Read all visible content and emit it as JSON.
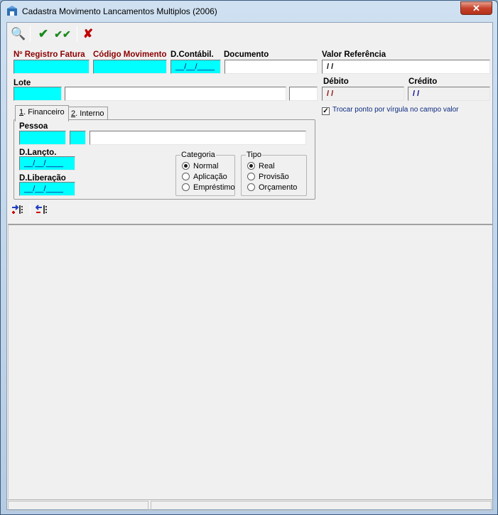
{
  "window": {
    "title": "Cadastra Movimento Lancamentos Multiplos (2006)",
    "close_label": "✕"
  },
  "toolbar": {
    "search_glyph": "🔍",
    "confirm_glyph": "✔",
    "confirm_all_glyph": "✔✔",
    "cancel_glyph": "✘"
  },
  "fields": {
    "registro_fatura": {
      "label": "Nº Registro Fatura",
      "value": ""
    },
    "codigo_movimento": {
      "label": "Código Movimento",
      "value": ""
    },
    "d_contabil": {
      "label": "D.Contábil.",
      "value": "__/__/____"
    },
    "documento": {
      "label": "Documento",
      "value": ""
    },
    "valor_referencia": {
      "label": "Valor Referência",
      "value": " / /"
    },
    "lote": {
      "label": "Lote",
      "value": "",
      "desc": "",
      "extra": ""
    },
    "debito": {
      "label": "Débito",
      "value": " / /"
    },
    "credito": {
      "label": "Crédito",
      "value": " / /"
    }
  },
  "tabs": [
    {
      "label_prefix": "1",
      "label": ". Financeiro"
    },
    {
      "label_prefix": "2",
      "label": ". Interno"
    }
  ],
  "financeiro": {
    "pessoa": {
      "label": "Pessoa",
      "code": "",
      "sub": "",
      "name": ""
    },
    "d_lancto": {
      "label": "D.Lançto.",
      "value": "__/__/____"
    },
    "d_liberacao": {
      "label": "D.Liberação",
      "value": "__/__/____"
    },
    "categoria": {
      "title": "Categoria",
      "options": [
        "Normal",
        "Aplicação",
        "Empréstimo"
      ],
      "selected": "Normal"
    },
    "tipo": {
      "title": "Tipo",
      "options": [
        "Real",
        "Provisão",
        "Orçamento"
      ],
      "selected": "Real"
    }
  },
  "options": {
    "trocar_ponto": {
      "label": "Trocar ponto por vírgula no campo valor",
      "checked": true,
      "mark": "✓"
    }
  },
  "row_tools": {
    "insert_glyph": "⇥",
    "delete_glyph": "⇤"
  },
  "colors": {
    "input_highlight": "#00ffff",
    "required_label": "#8b0000",
    "check_label": "#0b2a80"
  }
}
